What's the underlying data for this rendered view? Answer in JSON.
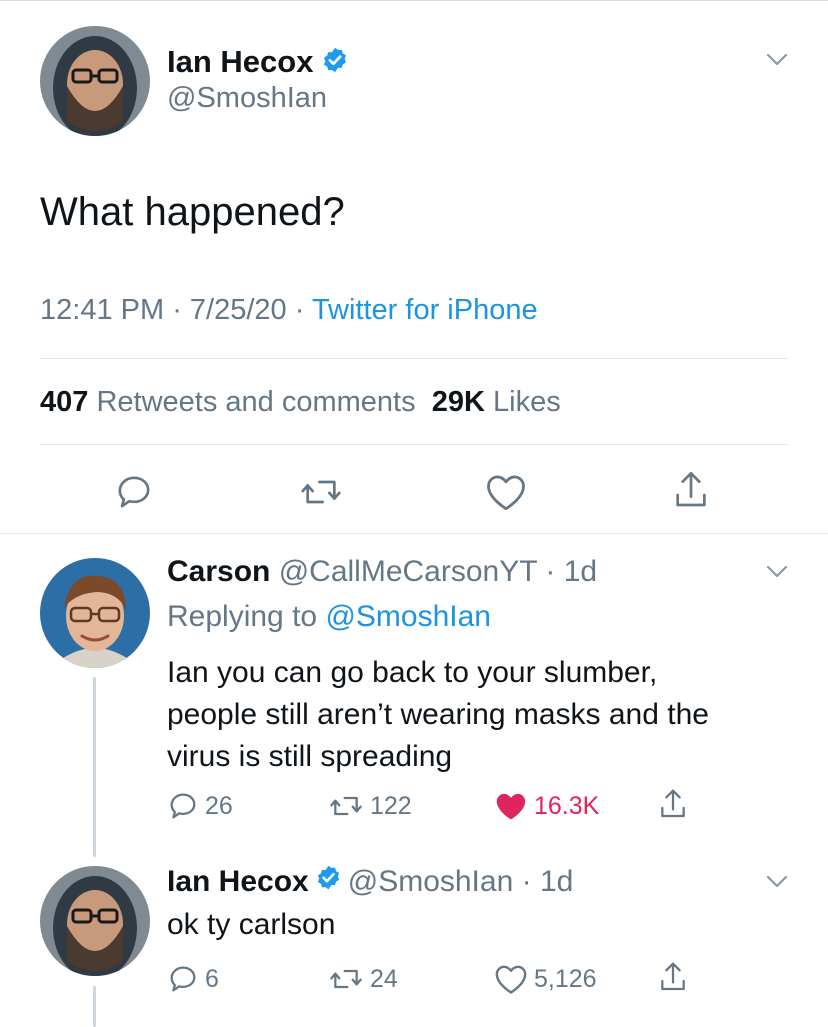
{
  "main_tweet": {
    "author_name": "Ian Hecox",
    "handle": "@SmoshIan",
    "text": "What happened?",
    "time": "12:41 PM",
    "date": "7/25/20",
    "source": "Twitter for iPhone",
    "retweets_count": "407",
    "retweets_label": "Retweets and comments",
    "likes_count": "29K",
    "likes_label": "Likes"
  },
  "replies": [
    {
      "author_name": "Carson",
      "handle": "@CallMeCarsonYT",
      "age": "1d",
      "replying_prefix": "Replying to",
      "replying_to": "@SmoshIan",
      "text_lines": [
        "Ian you can go back to your slumber,",
        "people still aren’t wearing masks and the",
        "virus is still spreading"
      ],
      "reply_count": "26",
      "retweet_count": "122",
      "like_count": "16.3K",
      "liked": true
    },
    {
      "author_name": "Ian Hecox",
      "handle": "@SmoshIan",
      "age": "1d",
      "text": "ok ty carlson",
      "reply_count": "6",
      "retweet_count": "24",
      "like_count": "5,126",
      "liked": false
    }
  ],
  "colors": {
    "accent": "#1b95e0",
    "liked": "#e0245e",
    "muted": "#657786",
    "text": "#0f1419"
  },
  "icons": [
    "verified-badge-icon",
    "chevron-down-icon",
    "reply-icon",
    "retweet-icon",
    "like-icon",
    "share-icon"
  ]
}
